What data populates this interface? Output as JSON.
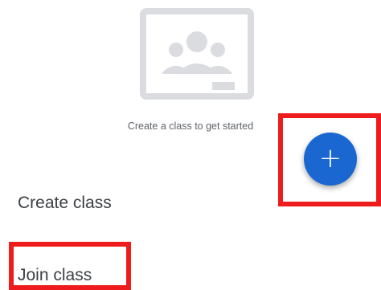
{
  "empty_state": {
    "illustration_icon": "classroom-board-icon",
    "message": "Create a class to get started"
  },
  "fab": {
    "icon": "plus-icon",
    "symbol": "+",
    "color": "#1a67d2"
  },
  "menu": {
    "create_label": "Create class",
    "join_label": "Join class"
  },
  "highlights": {
    "color": "#ee1c1c"
  }
}
